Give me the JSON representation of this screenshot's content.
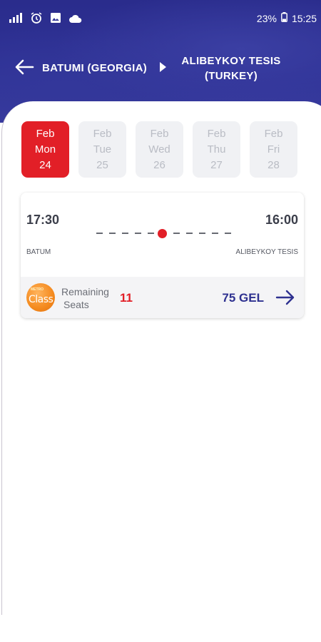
{
  "status_bar": {
    "battery": "23%",
    "time": "15:25"
  },
  "route": {
    "from": "BATUMI (GEORGIA)",
    "to_line1": "ALIBEYKOY TESIS",
    "to_line2": "(TURKEY)"
  },
  "dates": [
    {
      "month": "Feb",
      "weekday": "Mon",
      "day": "24",
      "selected": true
    },
    {
      "month": "Feb",
      "weekday": "Tue",
      "day": "25",
      "selected": false
    },
    {
      "month": "Feb",
      "weekday": "Wed",
      "day": "26",
      "selected": false
    },
    {
      "month": "Feb",
      "weekday": "Thu",
      "day": "27",
      "selected": false
    },
    {
      "month": "Feb",
      "weekday": "Fri",
      "day": "28",
      "selected": false
    }
  ],
  "trip": {
    "departure_time": "17:30",
    "arrival_time": "16:00",
    "departure_city": "BATUM",
    "arrival_city": "ALIBEYKOY TESIS",
    "remaining_label_1": "Remaining",
    "remaining_label_2": "Seats",
    "remaining_seats": "11",
    "price": "75 GEL",
    "operator_logo_text": "Class"
  },
  "colors": {
    "header": "#2f3296",
    "accent_red": "#e21f27",
    "price_blue": "#2e3190"
  }
}
